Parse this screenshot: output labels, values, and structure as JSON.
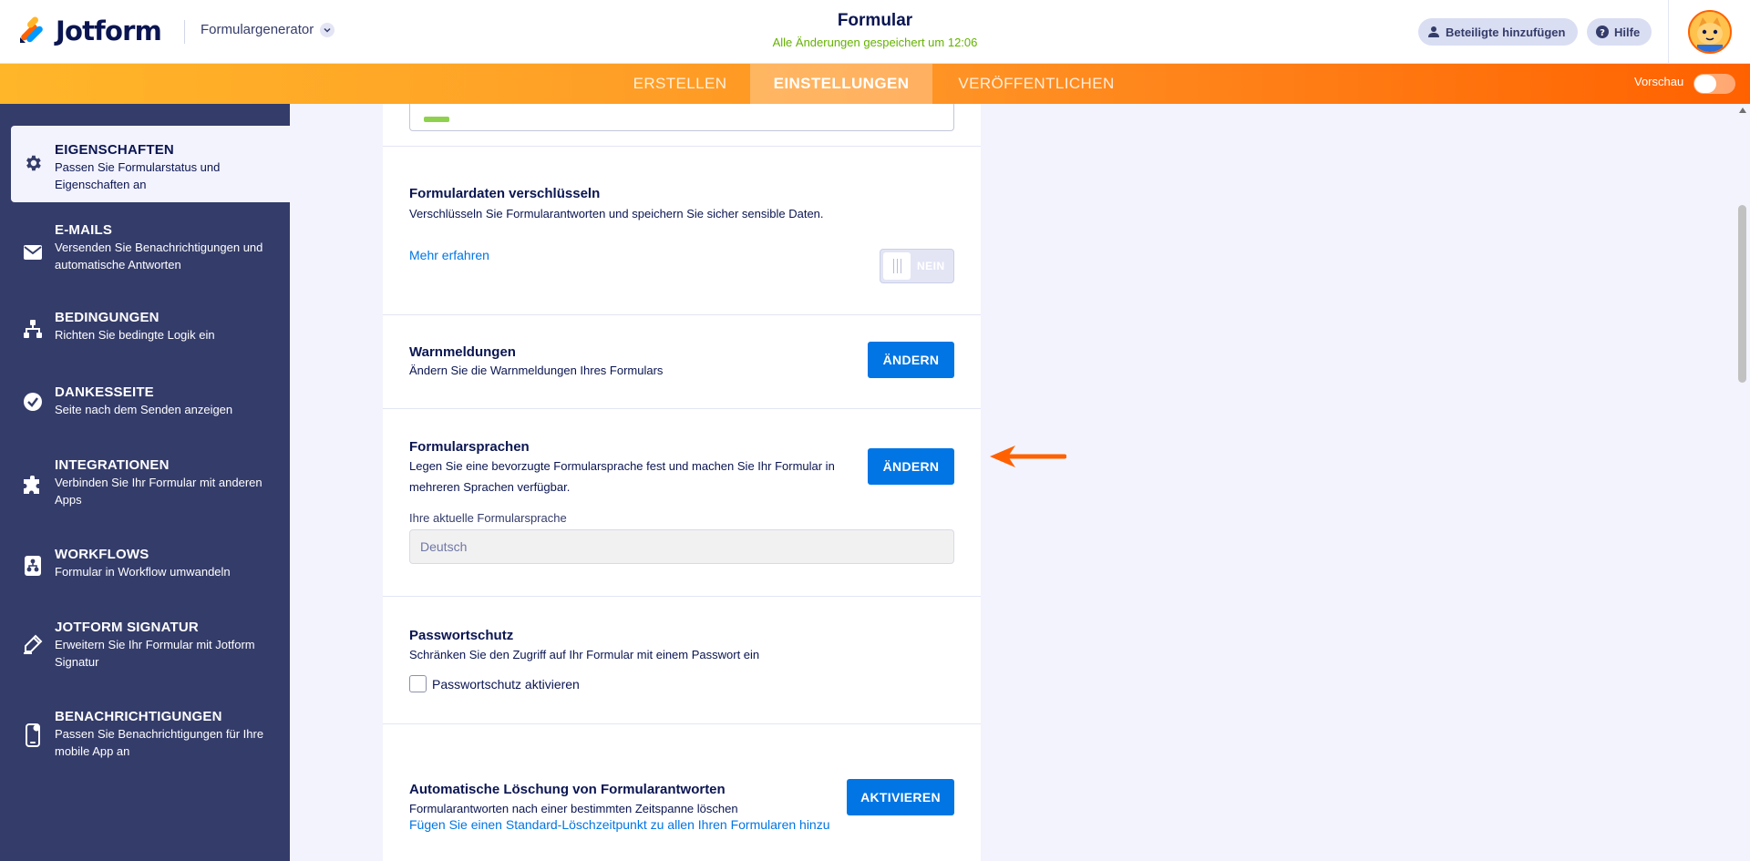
{
  "header": {
    "logo_text": "Jotform",
    "builder_switch": "Formulargenerator",
    "form_title": "Formular",
    "save_status": "Alle Änderungen gespeichert um 12:06",
    "invite_label": "Beteiligte hinzufügen",
    "help_label": "Hilfe"
  },
  "nav": {
    "tabs": [
      {
        "label": "ERSTELLEN"
      },
      {
        "label": "EINSTELLUNGEN"
      },
      {
        "label": "VERÖFFENTLICHEN"
      }
    ],
    "active_tab": "EINSTELLUNGEN",
    "preview_label": "Vorschau",
    "preview_enabled": false
  },
  "sidebar": {
    "items": [
      {
        "title": "EIGENSCHAFTEN",
        "desc": "Passen Sie Formularstatus und Eigenschaften an",
        "icon": "gear-icon"
      },
      {
        "title": "E-MAILS",
        "desc": "Versenden Sie Benachrichtigungen und automatische Antworten",
        "icon": "envelope-icon"
      },
      {
        "title": "BEDINGUNGEN",
        "desc": "Richten Sie bedingte Logik ein",
        "icon": "hierarchy-icon"
      },
      {
        "title": "DANKESSEITE",
        "desc": "Seite nach dem Senden anzeigen",
        "icon": "check-circle-icon"
      },
      {
        "title": "INTEGRATIONEN",
        "desc": "Verbinden Sie Ihr Formular mit anderen Apps",
        "icon": "puzzle-icon"
      },
      {
        "title": "WORKFLOWS",
        "desc": "Formular in Workflow umwandeln",
        "icon": "workflow-icon"
      },
      {
        "title": "JOTFORM SIGNATUR",
        "desc": "Erweitern Sie Ihr Formular mit Jotform Signatur",
        "icon": "pen-icon"
      },
      {
        "title": "BENACHRICHTIGUNGEN",
        "desc": "Passen Sie Benachrichtigungen für Ihre mobile App an",
        "icon": "mobile-icon"
      }
    ],
    "active_item": "EIGENSCHAFTEN"
  },
  "settings": {
    "encrypt": {
      "title": "Formulardaten verschlüsseln",
      "desc": "Verschlüsseln Sie Formularantworten und speichern Sie sicher sensible Daten.",
      "link": "Mehr erfahren",
      "toggle_label": "NEIN"
    },
    "warnings": {
      "title": "Warnmeldungen",
      "desc": "Ändern Sie die Warnmeldungen Ihres Formulars",
      "button": "ÄNDERN"
    },
    "languages": {
      "title": "Formularsprachen",
      "desc": "Legen Sie eine bevorzugte Formularsprache fest und machen Sie Ihr Formular in mehreren Sprachen verfügbar.",
      "button": "ÄNDERN",
      "current_label": "Ihre aktuelle Formularsprache",
      "current_value": "Deutsch"
    },
    "password": {
      "title": "Passwortschutz",
      "desc": "Schränken Sie den Zugriff auf Ihr Formular mit einem Passwort ein",
      "checkbox_label": "Passwortschutz aktivieren",
      "checked": false
    },
    "auto_delete": {
      "title": "Automatische Löschung von Formularantworten",
      "desc": "Formularantworten nach einer bestimmten Zeitspanne löschen",
      "button": "AKTIVIEREN",
      "link": "Fügen Sie einen Standard-Löschzeitpunkt zu allen Ihren Formularen hinzu"
    }
  },
  "colors": {
    "accent_orange": "#ff6100",
    "primary_blue": "#0075e3",
    "sidebar_bg": "#343c6a",
    "save_green": "#64b200"
  }
}
